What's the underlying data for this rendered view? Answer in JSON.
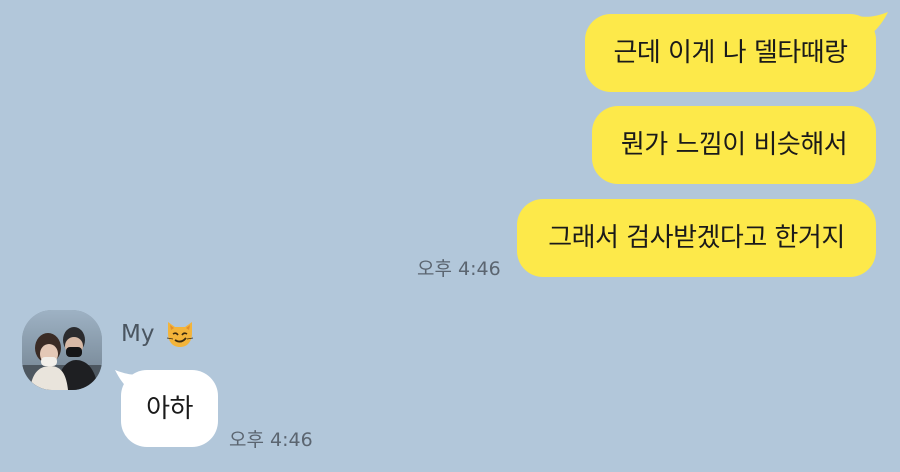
{
  "outgoing_messages": [
    {
      "text": "근데 이게 나 델타때랑"
    },
    {
      "text": "뭔가 느낌이 비슷해서"
    },
    {
      "text": "그래서 검사받겠다고 한거지"
    }
  ],
  "outgoing_time": "오후 4:46",
  "incoming": {
    "sender_name": "My",
    "sender_emoji": "smirking-cat-emoji",
    "messages": [
      {
        "text": "아하"
      }
    ],
    "time": "오후 4:46"
  },
  "colors": {
    "background": "#b2c7da",
    "outgoing_bubble": "#fde94a",
    "incoming_bubble": "#ffffff"
  }
}
